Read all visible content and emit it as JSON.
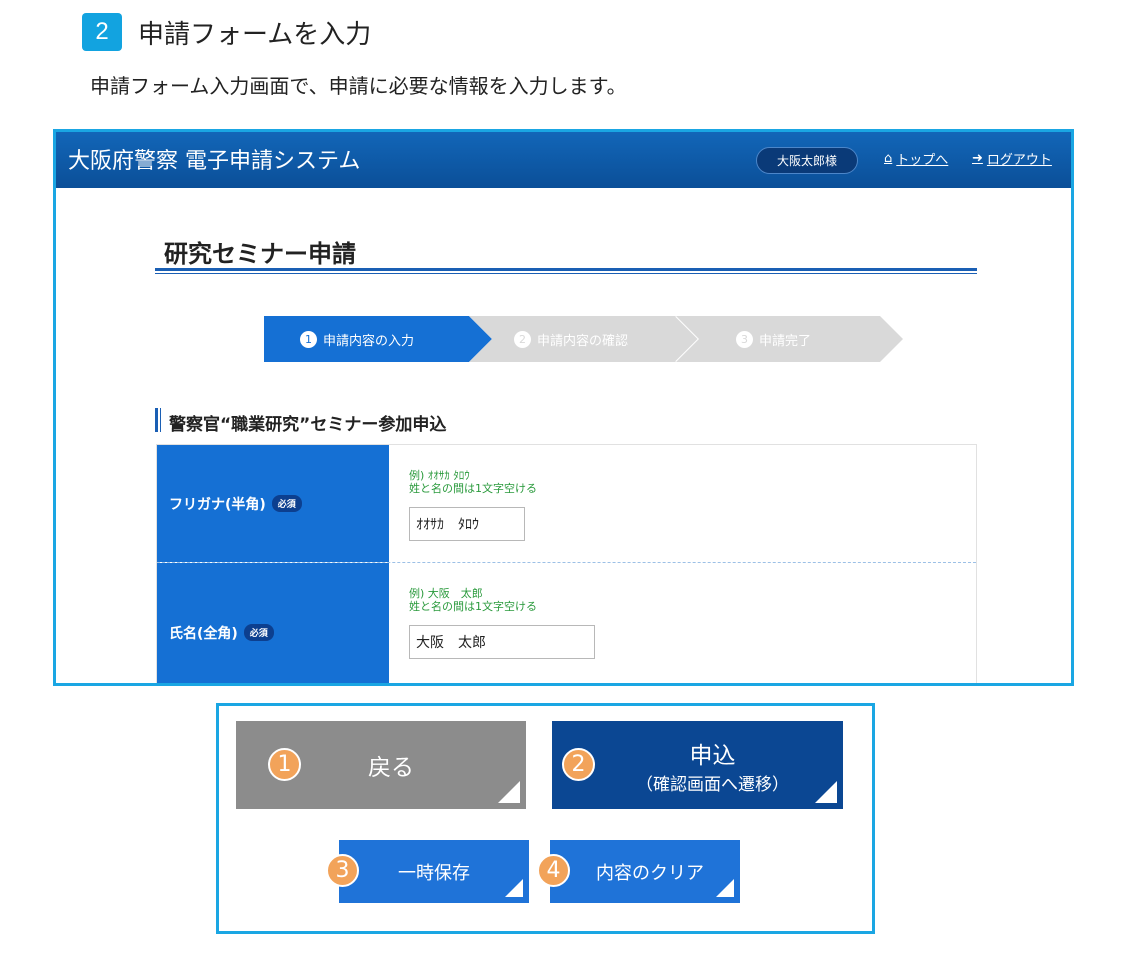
{
  "step": {
    "number": "2",
    "title": "申請フォームを入力",
    "description": "申請フォーム入力画面で、申請に必要な情報を入力します。"
  },
  "app": {
    "title": "大阪府警察 電子申請システム",
    "user": "大阪太郎様",
    "home_link": "トップへ",
    "logout_link": "ログアウト",
    "page_title": "研究セミナー申請"
  },
  "progress": [
    {
      "num": "1",
      "label": "申請内容の入力",
      "active": true
    },
    {
      "num": "2",
      "label": "申請内容の確認",
      "active": false
    },
    {
      "num": "3",
      "label": "申請完了",
      "active": false
    }
  ],
  "section_title": "警察官“職業研究”セミナー参加申込",
  "form": {
    "required_badge": "必須",
    "rows": [
      {
        "label": "フリガナ(半角)",
        "hint1": "例) ｵｵｻｶ ﾀﾛｳ",
        "hint2": "姓と名の間は1文字空ける",
        "value": "ｵｵｻｶ　ﾀﾛｳ"
      },
      {
        "label": "氏名(全角)",
        "hint1": "例) 大阪　太郎",
        "hint2": "姓と名の間は1文字空ける",
        "value": "大阪　太郎"
      }
    ]
  },
  "buttons": {
    "back": {
      "num": "1",
      "label": "戻る"
    },
    "apply": {
      "num": "2",
      "label": "申込",
      "sub": "（確認画面へ遷移）"
    },
    "save": {
      "num": "3",
      "label": "一時保存"
    },
    "clear": {
      "num": "4",
      "label": "内容のクリア"
    }
  },
  "colors": {
    "accent": "#1aa6e3",
    "header": "#0d5aa9",
    "label_bg": "#1570d4",
    "apply": "#0b4793",
    "back": "#8c8c8c",
    "badge": "#f2a35a"
  }
}
